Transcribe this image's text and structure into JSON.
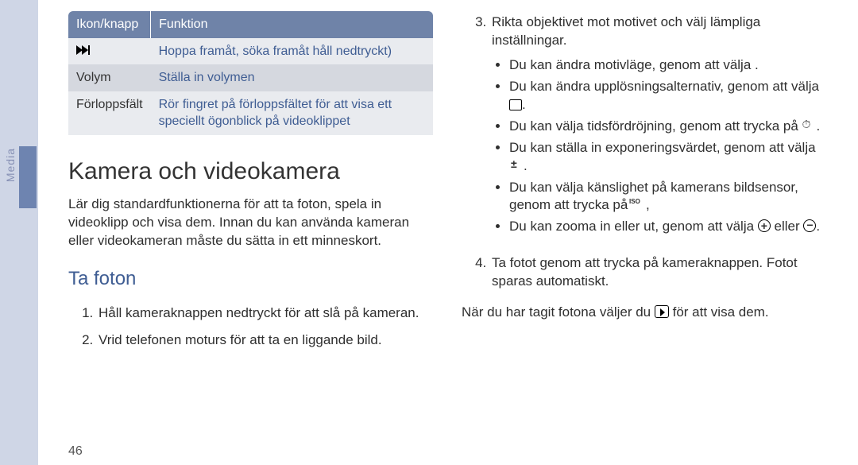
{
  "side": {
    "label": "Media"
  },
  "table": {
    "headers": [
      "Ikon/knapp",
      "Funktion"
    ],
    "rows": [
      {
        "icon": "fast-forward-icon",
        "key_text": "",
        "func": "Hoppa framåt, söka framåt håll nedtryckt)"
      },
      {
        "key_text": "Volym",
        "func": "Ställa in volymen"
      },
      {
        "key_text": "Förloppsfält",
        "func": "Rör fingret på förloppsfältet för att visa ett speciellt ögonblick på videoklippet"
      }
    ]
  },
  "heading": "Kamera och videokamera",
  "intro": "Lär dig standardfunktionerna för att ta foton, spela in videoklipp och visa dem. Innan du kan använda kameran eller videokameran måste du sätta in ett minneskort.",
  "subheading": "Ta foton",
  "left_steps": {
    "s1": "Håll kameraknappen nedtryckt för att slå på kameran.",
    "s2": "Vrid telefonen moturs för att ta en liggande bild."
  },
  "right": {
    "s3": "Rikta objektivet mot motivet och välj lämpliga inställningar.",
    "bullets": {
      "b1": "Du kan ändra motivläge, genom att välja      .",
      "b2a": "Du kan ändra upplösningsalternativ, genom att välja ",
      "b2b": "",
      "b3a": "Du kan välja tidsfördröjning, genom att trycka på ",
      "b3b": "",
      "b4a": "Du kan ställa in exponeringsvärdet, genom att välja ",
      "b4b": "",
      "b5a": "Du kan välja känslighet på kamerans bildsensor, genom att trycka på ",
      "b5b": ",",
      "b6a": "Du kan zooma in eller ut, genom att välja ",
      "b6mid": " eller ",
      "b6b": "."
    },
    "s4": "Ta fotot genom att trycka på kameraknappen. Fotot sparas automatiskt.",
    "after_a": "När du har tagit fotona väljer du ",
    "after_b": " för att visa dem."
  },
  "page_number": "46"
}
